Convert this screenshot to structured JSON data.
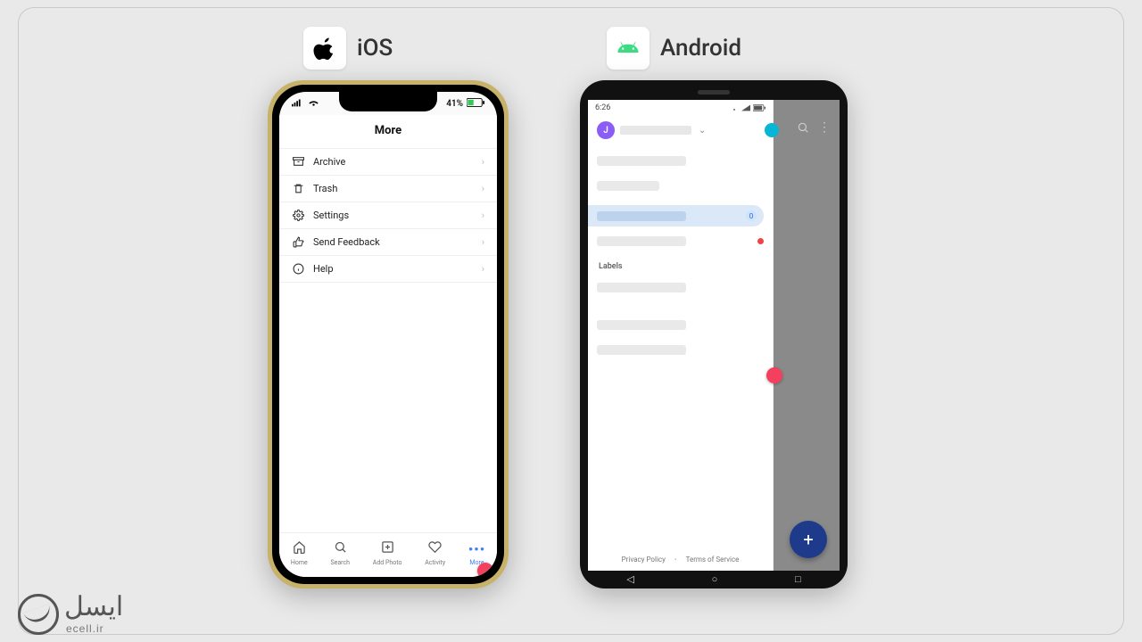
{
  "platforms": {
    "ios_label": "iOS",
    "android_label": "Android"
  },
  "ios": {
    "status": {
      "battery": "41%"
    },
    "title": "More",
    "menu": [
      {
        "label": "Archive"
      },
      {
        "label": "Trash"
      },
      {
        "label": "Settings"
      },
      {
        "label": "Send Feedback"
      },
      {
        "label": "Help"
      }
    ],
    "tabs": [
      {
        "label": "Home"
      },
      {
        "label": "Search"
      },
      {
        "label": "Add Photo"
      },
      {
        "label": "Activity"
      },
      {
        "label": "More"
      }
    ]
  },
  "android": {
    "status": {
      "time": "6:26"
    },
    "avatar_initial": "J",
    "badge": "0",
    "section_label": "Labels",
    "footer": {
      "privacy": "Privacy Policy",
      "terms": "Terms of Service"
    },
    "fab": "+"
  },
  "watermark": {
    "brand_fa": "ایسل",
    "brand_en": "ecell.ir"
  }
}
